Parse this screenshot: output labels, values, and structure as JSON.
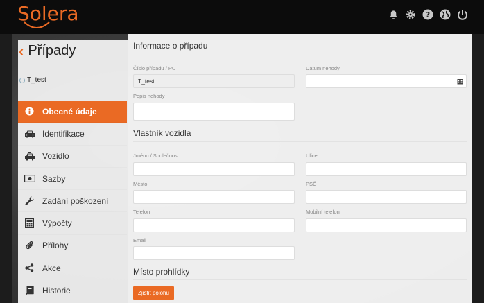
{
  "brand": {
    "logo_text": "Solera",
    "accent": "#ea6a24"
  },
  "topbar": {
    "icons": [
      "bell-icon",
      "gear-icon",
      "help-icon",
      "globe-icon",
      "power-icon"
    ]
  },
  "sidebar": {
    "title": "Případy",
    "case_id": "T_test",
    "items": [
      {
        "label": "Obecné údaje",
        "icon": "info-icon",
        "active": true
      },
      {
        "label": "Identifikace",
        "icon": "car-icon"
      },
      {
        "label": "Vozidlo",
        "icon": "taxi-icon"
      },
      {
        "label": "Sazby",
        "icon": "money-icon"
      },
      {
        "label": "Zadání poškození",
        "icon": "wrench-icon"
      },
      {
        "label": "Výpočty",
        "icon": "calculator-icon"
      },
      {
        "label": "Přílohy",
        "icon": "paperclip-icon"
      },
      {
        "label": "Akce",
        "icon": "share-icon"
      },
      {
        "label": "Historie",
        "icon": "book-icon"
      }
    ]
  },
  "main": {
    "case_section": {
      "title": "Informace o případu",
      "case_number_label": "Číslo případu / PU",
      "case_number_value": "T_test",
      "accident_date_label": "Datum nehody",
      "accident_date_value": "",
      "description_label": "Popis nehody",
      "description_value": ""
    },
    "owner_section": {
      "title": "Vlastník vozidla",
      "name_label": "Jméno / Společnost",
      "street_label": "Ulice",
      "city_label": "Město",
      "zip_label": "PSČ",
      "phone_label": "Telefon",
      "mobile_label": "Mobilní telefon",
      "email_label": "Email"
    },
    "inspection_section": {
      "title": "Místo prohlídky",
      "locate_button": "Zjistit polohu"
    }
  }
}
